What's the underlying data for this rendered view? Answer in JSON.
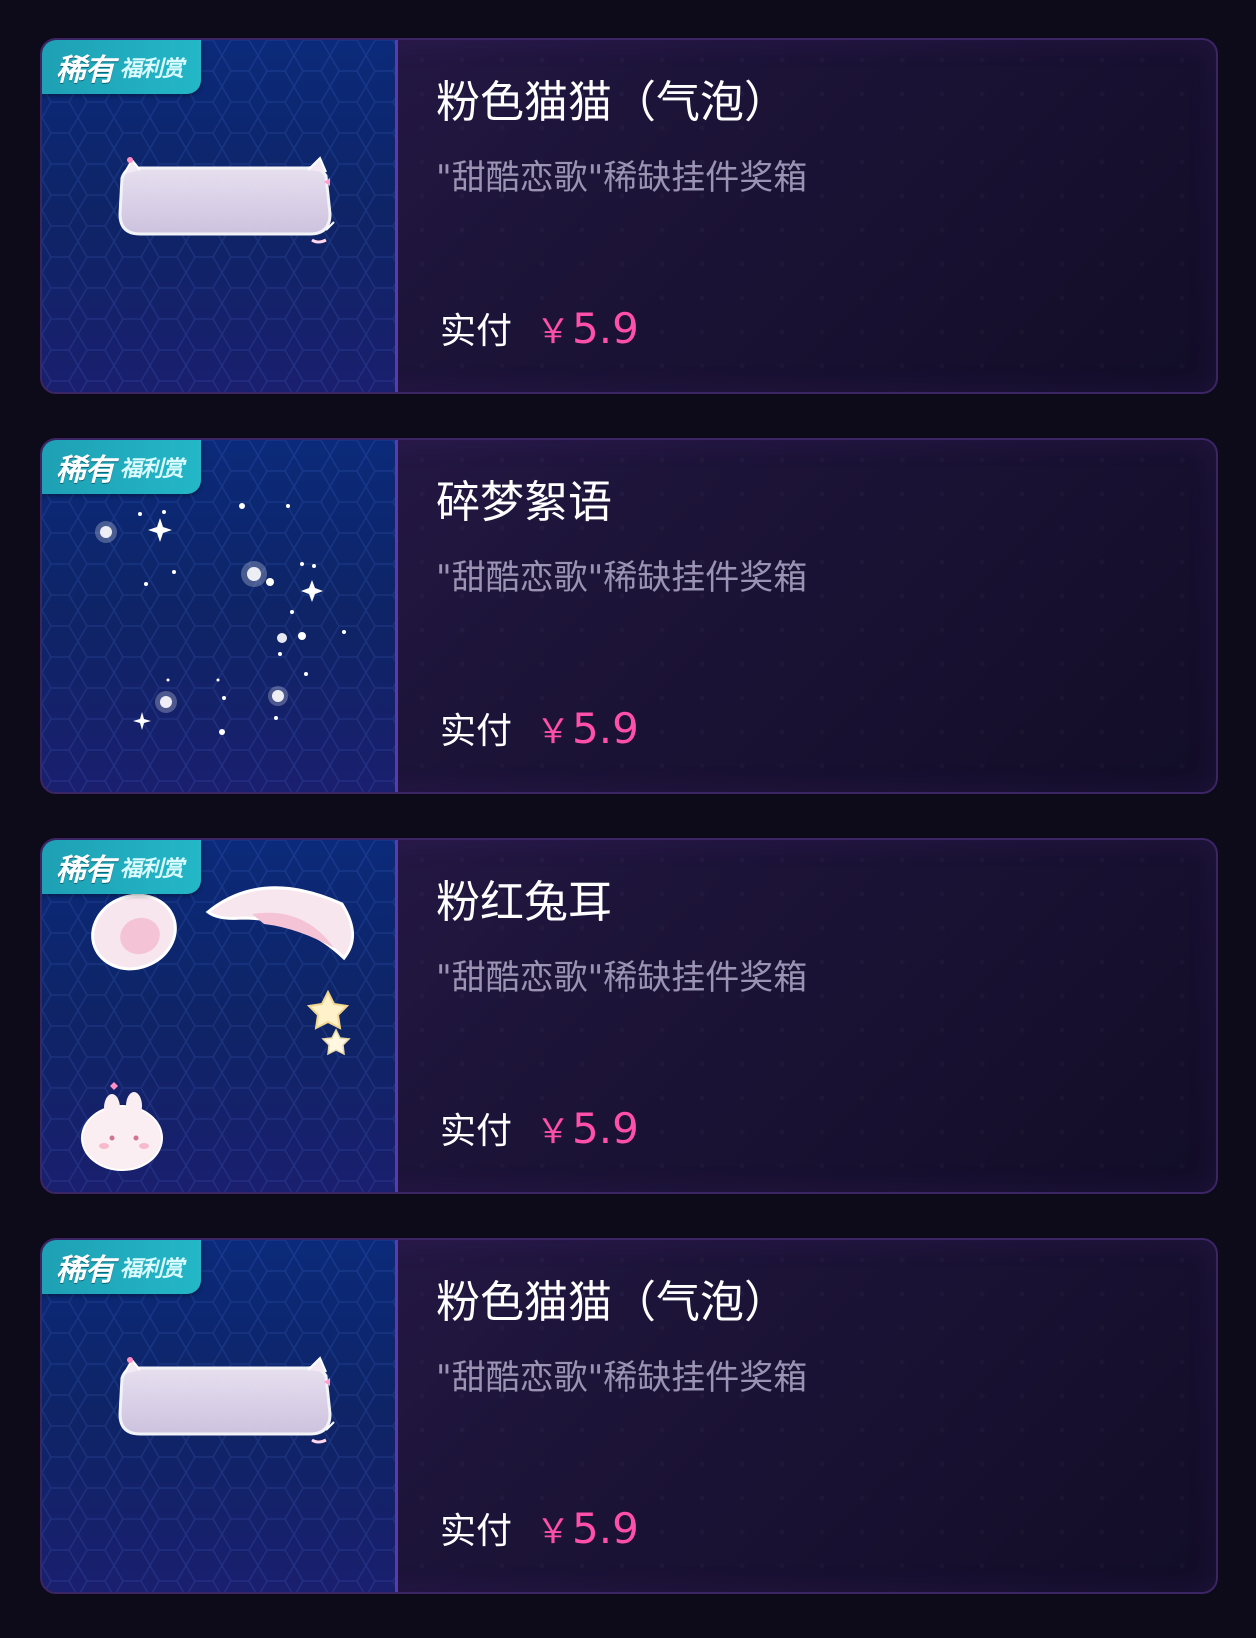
{
  "items": [
    {
      "badge_main": "稀有",
      "badge_sub": "福利赏",
      "title": "粉色猫猫（气泡）",
      "subtitle": "\"甜酷恋歌\"稀缺挂件奖箱",
      "price_label": "实付",
      "currency": "￥",
      "price": "5.9",
      "image": "bubble-frame"
    },
    {
      "badge_main": "稀有",
      "badge_sub": "福利赏",
      "title": "碎梦絮语",
      "subtitle": "\"甜酷恋歌\"稀缺挂件奖箱",
      "price_label": "实付",
      "currency": "￥",
      "price": "5.9",
      "image": "sparkles"
    },
    {
      "badge_main": "稀有",
      "badge_sub": "福利赏",
      "title": "粉红兔耳",
      "subtitle": "\"甜酷恋歌\"稀缺挂件奖箱",
      "price_label": "实付",
      "currency": "￥",
      "price": "5.9",
      "image": "bunny-ears"
    },
    {
      "badge_main": "稀有",
      "badge_sub": "福利赏",
      "title": "粉色猫猫（气泡）",
      "subtitle": "\"甜酷恋歌\"稀缺挂件奖箱",
      "price_label": "实付",
      "currency": "￥",
      "price": "5.9",
      "image": "bubble-frame"
    }
  ],
  "colors": {
    "page_bg": "#0d0a1a",
    "price": "#ff4fa8",
    "badge": "#23b7c8",
    "thumb_bg": "#0e2466"
  }
}
